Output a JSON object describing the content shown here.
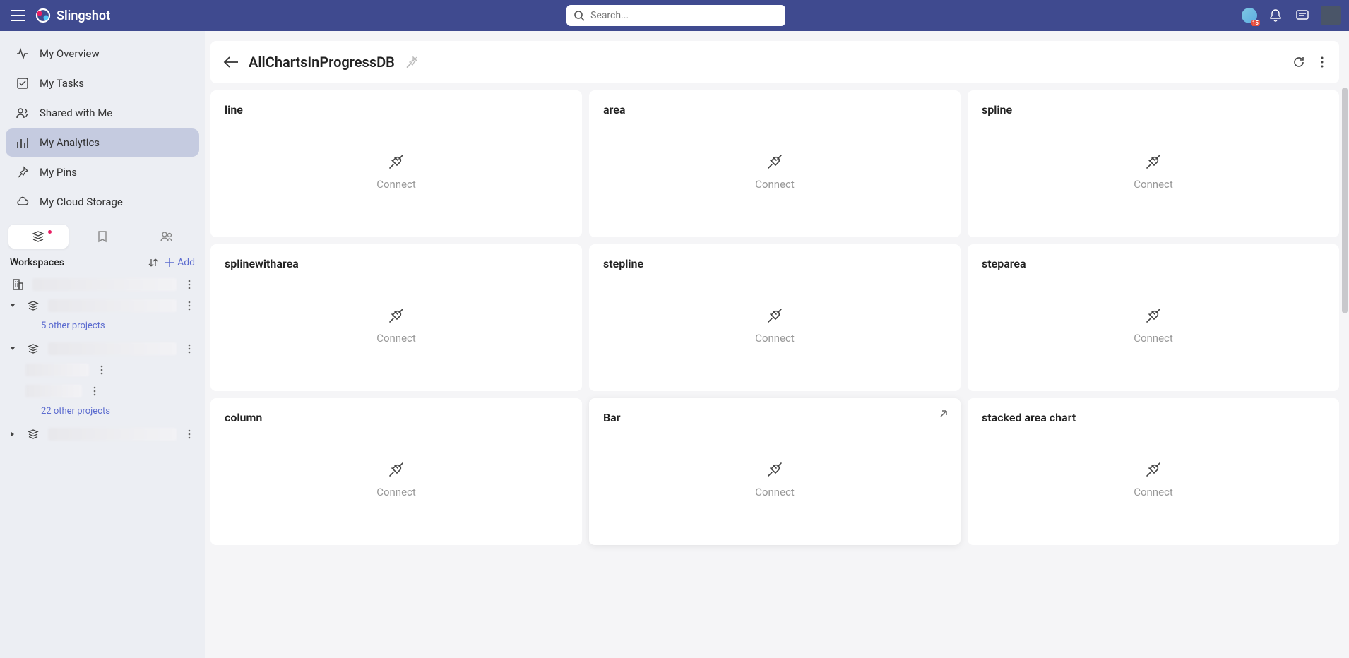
{
  "brand": "Slingshot",
  "search": {
    "placeholder": "Search..."
  },
  "avatar_badge": "15",
  "nav": {
    "overview": "My Overview",
    "tasks": "My Tasks",
    "shared": "Shared with Me",
    "analytics": "My Analytics",
    "pins": "My Pins",
    "cloud": "My Cloud Storage"
  },
  "workspaces_label": "Workspaces",
  "add_label": "Add",
  "ws_sublinks": {
    "five_other": "5 other projects",
    "twentytwo_other": "22 other projects"
  },
  "page": {
    "title": "AllChartsInProgressDB"
  },
  "connect_label": "Connect",
  "cards": [
    {
      "title": "line"
    },
    {
      "title": "area"
    },
    {
      "title": "spline"
    },
    {
      "title": "splinewitharea"
    },
    {
      "title": "stepline"
    },
    {
      "title": "steparea"
    },
    {
      "title": "column"
    },
    {
      "title": "Bar",
      "hovered": true
    },
    {
      "title": "stacked area chart"
    }
  ]
}
